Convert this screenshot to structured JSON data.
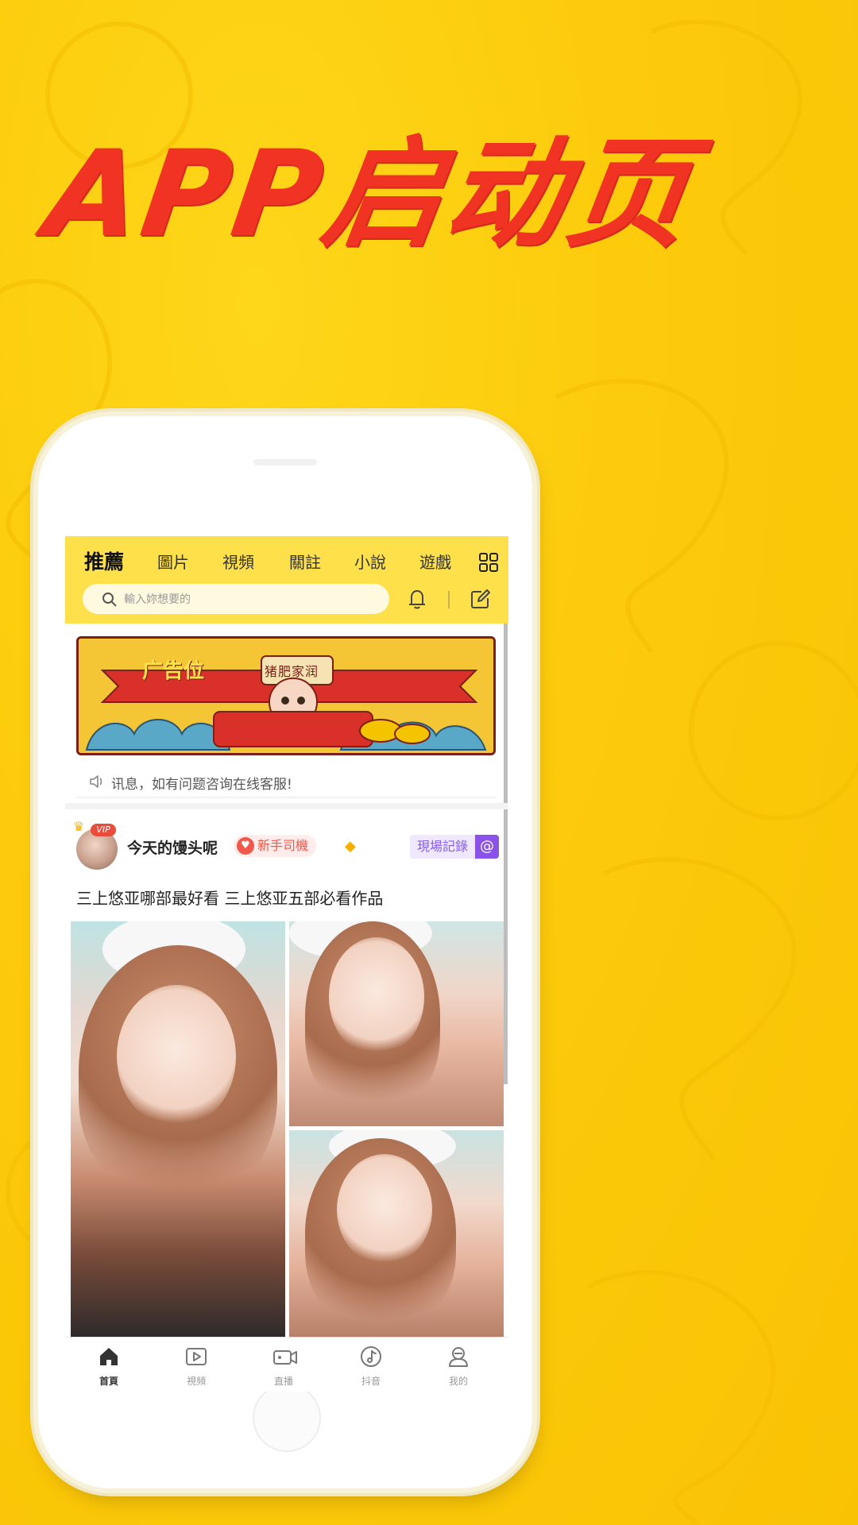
{
  "headline": "APP启动页",
  "header": {
    "tabs": [
      {
        "label": "推薦",
        "active": true
      },
      {
        "label": "圖片",
        "active": false
      },
      {
        "label": "視頻",
        "active": false
      },
      {
        "label": "關註",
        "active": false
      },
      {
        "label": "小說",
        "active": false
      },
      {
        "label": "遊戲",
        "active": false
      }
    ],
    "search_placeholder": "輸入妳想要的"
  },
  "banner": {
    "label": "广告位",
    "sign": "猪肥家润"
  },
  "notice": {
    "text": "讯息，如有问题咨询在线客服!"
  },
  "post": {
    "vip_label": "VIP",
    "username": "今天的馒头呢",
    "badge": "新手司機",
    "record_label": "現場記錄",
    "at_symbol": "@",
    "title": "三上悠亚哪部最好看 三上悠亚五部必看作品"
  },
  "bottom_nav": [
    {
      "label": "首頁",
      "icon": "home-icon",
      "active": true
    },
    {
      "label": "視頻",
      "icon": "video-icon",
      "active": false
    },
    {
      "label": "直播",
      "icon": "live-camera-icon",
      "active": false
    },
    {
      "label": "抖音",
      "icon": "music-note-icon",
      "active": false
    },
    {
      "label": "我的",
      "icon": "profile-icon",
      "active": false
    }
  ],
  "colors": {
    "background": "#fccb0b",
    "headline": "#f03323",
    "header": "#fde04a",
    "badge": "#f0584a",
    "record": "#8660e6"
  }
}
